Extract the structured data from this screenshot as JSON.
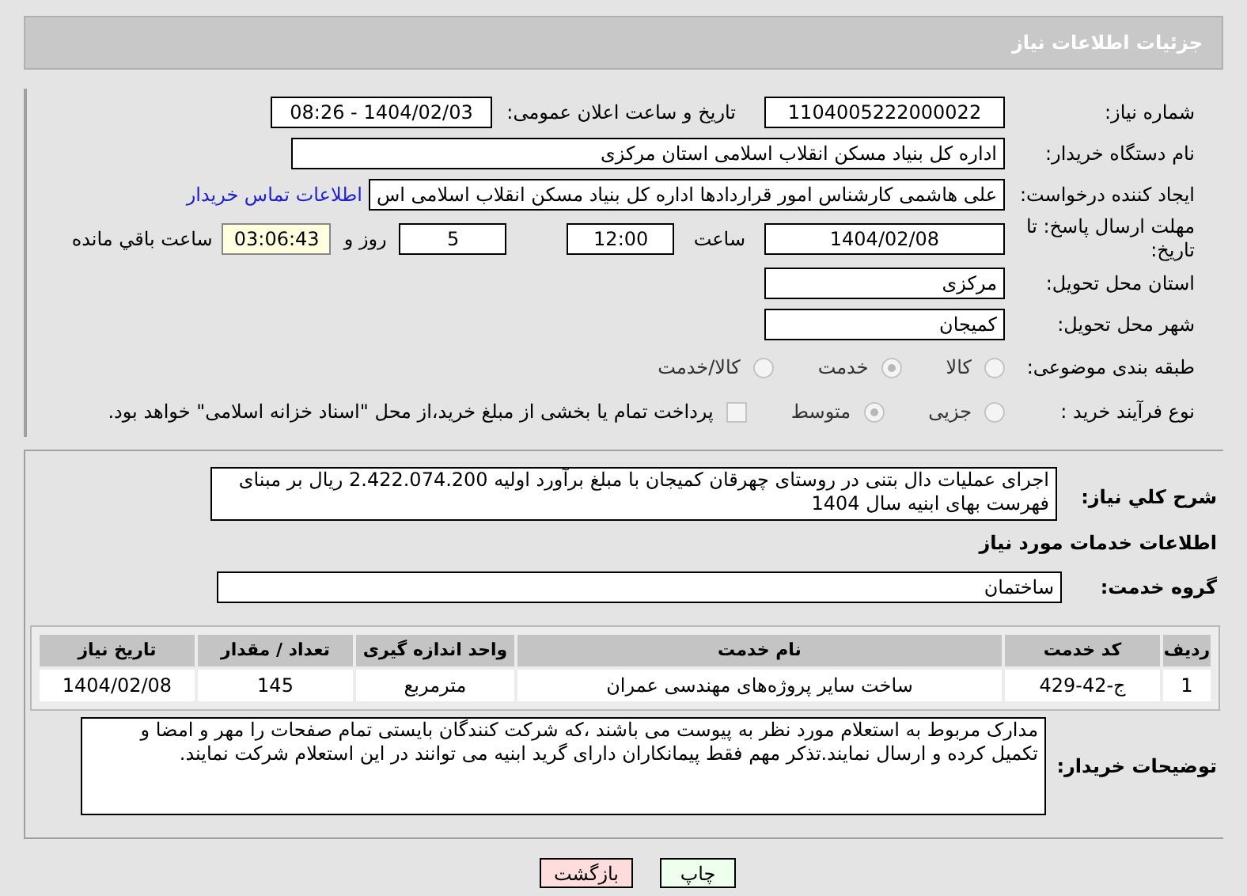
{
  "title": "جزئیات اطلاعات نیاز",
  "need_number": {
    "label": "شماره نیاز:",
    "value": "1104005222000022"
  },
  "announce": {
    "label": "تاریخ و ساعت اعلان عمومی:",
    "value": "1404/02/03 - 08:26"
  },
  "buyer": {
    "label": "نام دستگاه خریدار:",
    "value": "اداره کل بنیاد مسکن انقلاب اسلامی استان مرکزی"
  },
  "requester": {
    "label": "ایجاد کننده درخواست:",
    "value": "علی هاشمی کارشناس امور قراردادها اداره کل بنیاد مسکن انقلاب اسلامی اس",
    "link": "اطلاعات تماس خریدار"
  },
  "deadline": {
    "label": "مهلت ارسال پاسخ: تا تاریخ:",
    "date": "1404/02/08",
    "time_label": "ساعت",
    "time": "12:00",
    "days": "5",
    "days_label": "روز و",
    "remaining": "03:06:43",
    "remaining_label": "ساعت باقي مانده"
  },
  "province": {
    "label": "استان محل تحویل:",
    "value": "مرکزی"
  },
  "city": {
    "label": "شهر محل تحویل:",
    "value": "کمیجان"
  },
  "category": {
    "label": "طبقه بندی موضوعی:",
    "options": [
      {
        "label": "کالا",
        "selected": false
      },
      {
        "label": "خدمت",
        "selected": true
      },
      {
        "label": "کالا/خدمت",
        "selected": false
      }
    ]
  },
  "purchase_type": {
    "label": "نوع فرآیند خرید :",
    "options": [
      {
        "label": "جزیی",
        "selected": false
      },
      {
        "label": "متوسط",
        "selected": true
      }
    ],
    "treasury": {
      "checked": false,
      "text": "پرداخت تمام یا بخشی از مبلغ خرید،از محل \"اسناد خزانه اسلامی\" خواهد بود."
    }
  },
  "description": {
    "label": "شرح کلي نياز:",
    "value": "اجرای عملیات دال بتنی در روستای چهرقان کمیجان با مبلغ برآورد اولیه  2.422.074.200  ریال بر مبنای فهرست بهای ابنیه سال 1404"
  },
  "services_heading": "اطلاعات خدمات مورد نیاز",
  "service_group": {
    "label": "گروه خدمت:",
    "value": "ساختمان"
  },
  "table": {
    "columns": [
      "ردیف",
      "کد خدمت",
      "نام خدمت",
      "واحد اندازه گیری",
      "تعداد / مقدار",
      "تاریخ نیاز"
    ],
    "rows": [
      [
        "1",
        "ج-42-429",
        "ساخت سایر پروژه‌های مهندسی عمران",
        "مترمربع",
        "145",
        "1404/02/08"
      ]
    ]
  },
  "buyer_notes": {
    "label": "توضیحات خریدار:",
    "value": "مدارک مربوط به استعلام مورد نظر به پیوست می باشند ،که شرکت کنندگان بایستی تمام صفحات را مهر و امضا و تکمیل کرده و ارسال نمایند.تذکر مهم فقط پیمانکاران دارای گرید ابنیه می توانند در این استعلام شرکت نمایند."
  },
  "buttons": [
    {
      "label": "چاپ",
      "kind": "print"
    },
    {
      "label": "بازگشت",
      "kind": "back"
    }
  ]
}
